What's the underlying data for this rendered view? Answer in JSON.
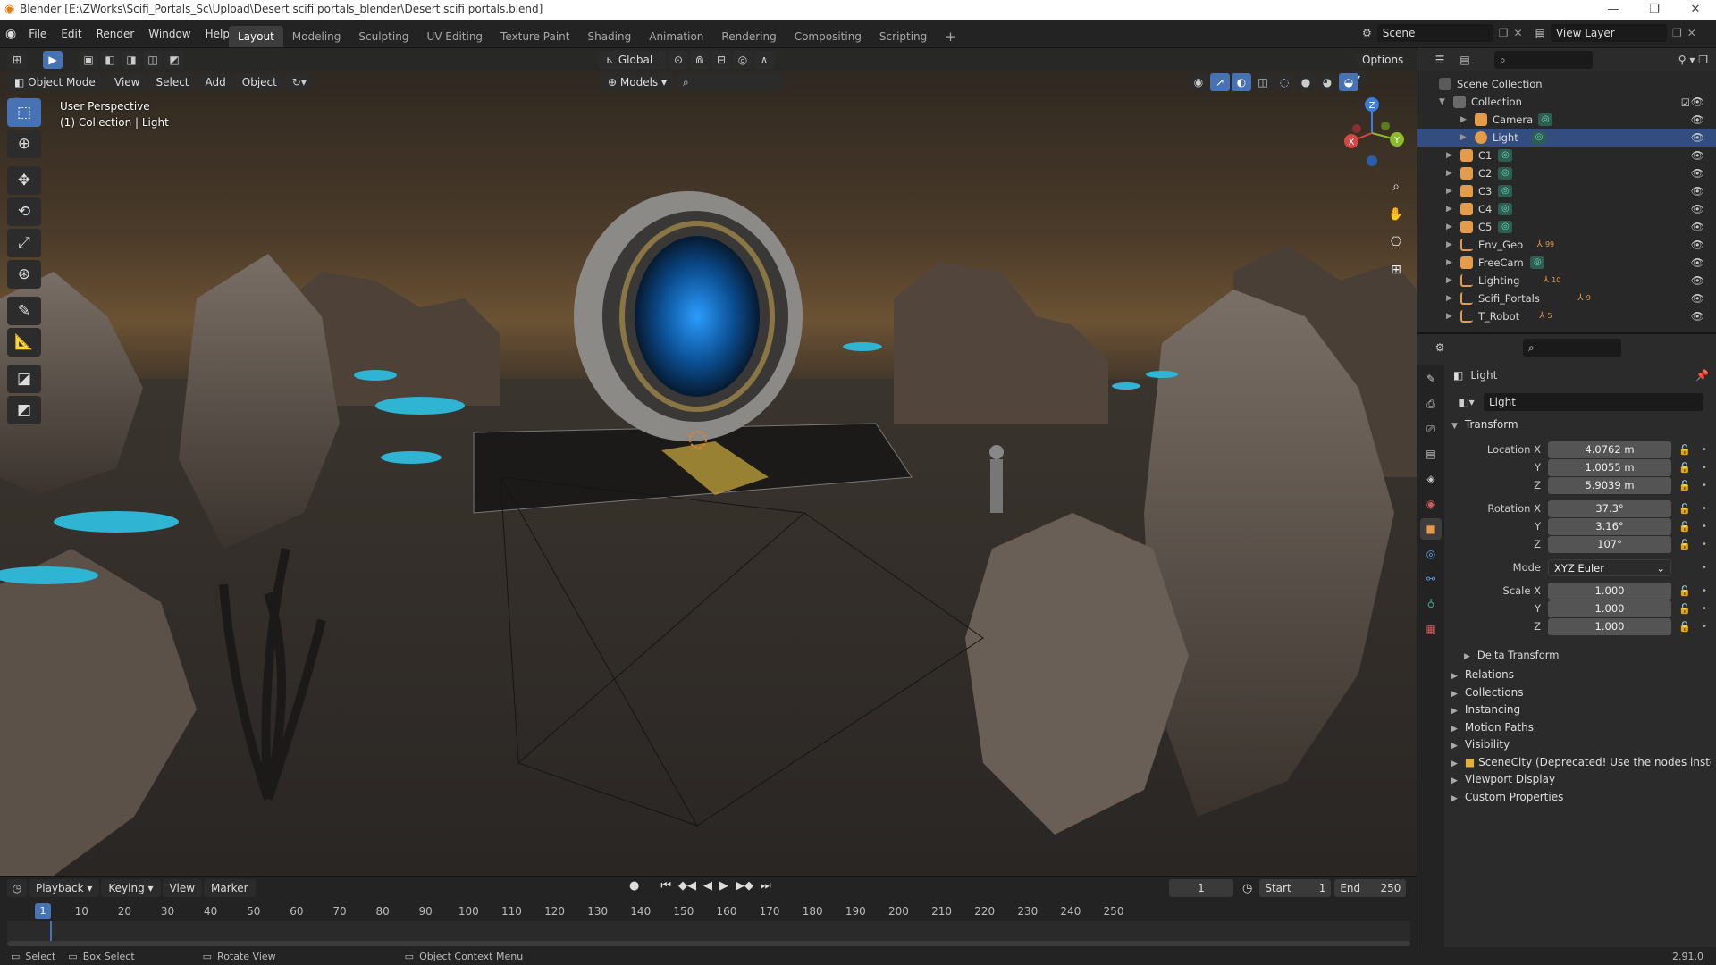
{
  "titlebar": {
    "title": "Blender [E:\\ZWorks\\Scifi_Portals_Sc\\Upload\\Desert scifi portals_blender\\Desert scifi portals.blend]",
    "minimize": "—",
    "maximize": "❐",
    "close": "✕"
  },
  "menus": [
    "File",
    "Edit",
    "Render",
    "Window",
    "Help"
  ],
  "workspaces": [
    "Layout",
    "Modeling",
    "Sculpting",
    "UV Editing",
    "Texture Paint",
    "Shading",
    "Animation",
    "Rendering",
    "Compositing",
    "Scripting"
  ],
  "workspace_add": "+",
  "scene": {
    "name": "Scene",
    "view_layer": "View Layer"
  },
  "viewport": {
    "header": {
      "orientation": "Global",
      "options": "Options"
    },
    "mode": "Object Mode",
    "menus": [
      "View",
      "Select",
      "Add",
      "Object"
    ],
    "collection_filter": "Models",
    "info_line1": "User Perspective",
    "info_line2": "(1) Collection | Light",
    "gizmo": {
      "x": "X",
      "y": "Y",
      "z": "Z"
    }
  },
  "timeline": {
    "menus": [
      "Playback",
      "Keying",
      "View",
      "Marker"
    ],
    "current_frame": "1",
    "start_label": "Start",
    "start": "1",
    "end_label": "End",
    "end": "250",
    "ticks": [
      "1",
      "10",
      "20",
      "30",
      "40",
      "50",
      "60",
      "70",
      "80",
      "90",
      "100",
      "110",
      "120",
      "130",
      "140",
      "150",
      "160",
      "170",
      "180",
      "190",
      "200",
      "210",
      "220",
      "230",
      "240",
      "250"
    ]
  },
  "statusbar": {
    "select": "Select",
    "box_select": "Box Select",
    "rotate_view": "Rotate View",
    "context_menu": "Object Context Menu",
    "version": "2.91.0"
  },
  "outliner": {
    "root": "Scene Collection",
    "collection": "Collection",
    "items": [
      {
        "label": "Camera",
        "type": "camera",
        "nested": true,
        "selected": false
      },
      {
        "label": "Light",
        "type": "light",
        "nested": true,
        "selected": true
      },
      {
        "label": "C1",
        "type": "camera",
        "nested": false,
        "selected": false
      },
      {
        "label": "C2",
        "type": "camera",
        "nested": false,
        "selected": false
      },
      {
        "label": "C3",
        "type": "camera",
        "nested": false,
        "selected": false
      },
      {
        "label": "C4",
        "type": "camera",
        "nested": false,
        "selected": false
      },
      {
        "label": "C5",
        "type": "camera",
        "nested": false,
        "selected": false
      },
      {
        "label": "Env_Geo",
        "type": "empty",
        "nested": false,
        "selected": false,
        "badge": "99"
      },
      {
        "label": "FreeCam",
        "type": "camera",
        "nested": false,
        "selected": false
      },
      {
        "label": "Lighting",
        "type": "empty",
        "nested": false,
        "selected": false,
        "badge": "10"
      },
      {
        "label": "Scifi_Portals",
        "type": "empty",
        "nested": false,
        "selected": false,
        "badge": "9"
      },
      {
        "label": "T_Robot",
        "type": "empty",
        "nested": false,
        "selected": false,
        "badge": "5"
      }
    ]
  },
  "properties": {
    "object_name": "Light",
    "datablock_name": "Light",
    "transform_label": "Transform",
    "location": {
      "label": "Location X",
      "x": "4.0762 m",
      "y": "1.0055 m",
      "z": "5.9039 m"
    },
    "rotation": {
      "label": "Rotation X",
      "x": "37.3°",
      "y": "3.16°",
      "z": "107°"
    },
    "mode": {
      "label": "Mode",
      "value": "XYZ Euler"
    },
    "scale": {
      "label": "Scale X",
      "x": "1.000",
      "y": "1.000",
      "z": "1.000"
    },
    "axis_y": "Y",
    "axis_z": "Z",
    "delta_transform": "Delta Transform",
    "panels": [
      "Relations",
      "Collections",
      "Instancing",
      "Motion Paths",
      "Visibility",
      "SceneCity (Deprecated! Use the nodes instead)",
      "Viewport Display",
      "Custom Properties"
    ]
  },
  "colors": {
    "accent": "#4772b3",
    "selected_row": "#334d80",
    "camera_icon": "#e39b4c",
    "light_icon": "#e39b4c",
    "data_green": "#3fa38a"
  }
}
